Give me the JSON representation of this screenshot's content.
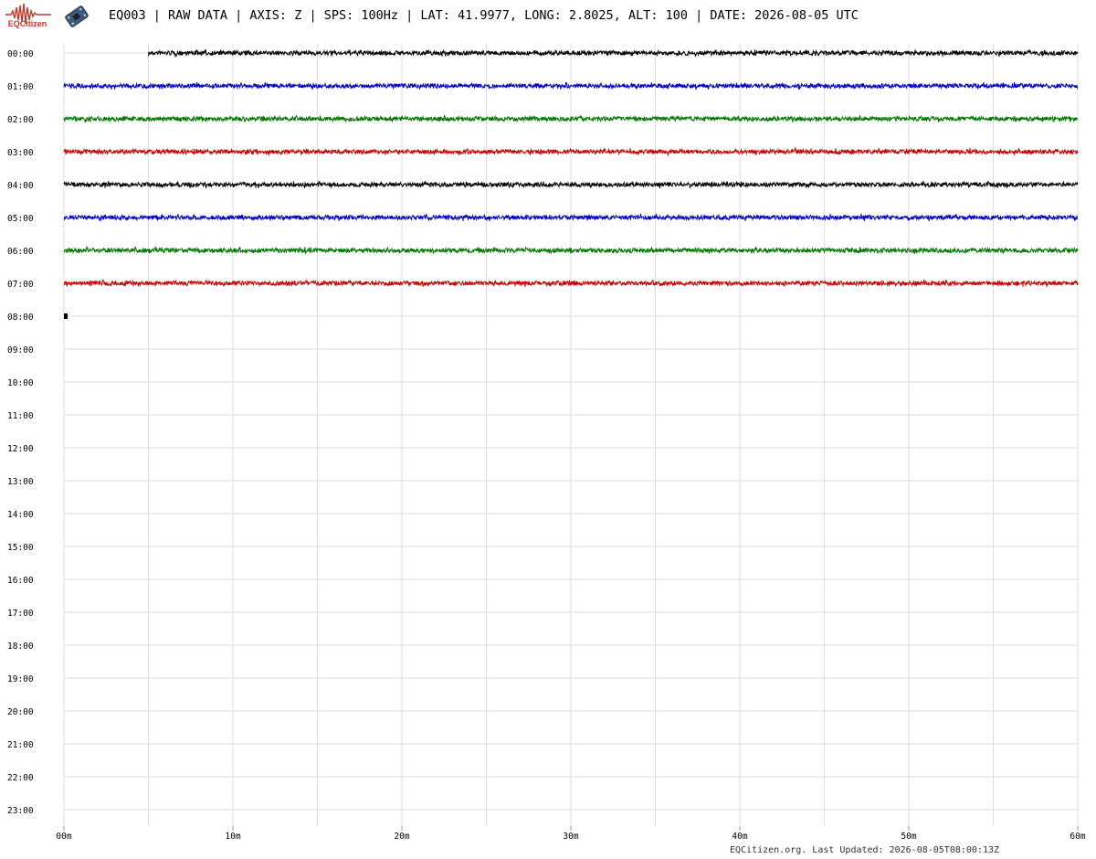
{
  "header": {
    "logo_text": "EQCitizen",
    "title": "EQ003 | RAW DATA | AXIS: Z | SPS: 100Hz | LAT: 41.9977, LONG: 2.8025, ALT: 100 | DATE: 2026-08-05 UTC"
  },
  "footer": {
    "text": "EQCitizen.org. Last Updated: 2026-08-05T08:00:13Z"
  },
  "colors": {
    "black": "#000000",
    "blue": "#0000cc",
    "green": "#007700",
    "red": "#cc0000",
    "grid": "#dddddd",
    "logo": "#c0392b"
  },
  "chart_data": {
    "type": "line",
    "title": "",
    "xlabel": "",
    "ylabel": "",
    "x_ticks": [
      "00m",
      "10m",
      "20m",
      "30m",
      "40m",
      "50m",
      "60m"
    ],
    "x_range_minutes": [
      0,
      60
    ],
    "grid_minor_every_minutes": 5,
    "y_labels": [
      "00:00",
      "01:00",
      "02:00",
      "03:00",
      "04:00",
      "05:00",
      "06:00",
      "07:00",
      "08:00",
      "09:00",
      "10:00",
      "11:00",
      "12:00",
      "13:00",
      "14:00",
      "15:00",
      "16:00",
      "17:00",
      "18:00",
      "19:00",
      "20:00",
      "21:00",
      "22:00",
      "23:00"
    ],
    "trace_color_cycle": [
      "black",
      "blue",
      "green",
      "red"
    ],
    "traces": [
      {
        "hour": "00:00",
        "start_min": 5,
        "end_min": 60,
        "color": "black"
      },
      {
        "hour": "01:00",
        "start_min": 0,
        "end_min": 60,
        "color": "blue"
      },
      {
        "hour": "02:00",
        "start_min": 0,
        "end_min": 60,
        "color": "green"
      },
      {
        "hour": "03:00",
        "start_min": 0,
        "end_min": 60,
        "color": "red"
      },
      {
        "hour": "04:00",
        "start_min": 0,
        "end_min": 60,
        "color": "black"
      },
      {
        "hour": "05:00",
        "start_min": 0,
        "end_min": 60,
        "color": "blue"
      },
      {
        "hour": "06:00",
        "start_min": 0,
        "end_min": 60,
        "color": "green"
      },
      {
        "hour": "07:00",
        "start_min": 0,
        "end_min": 60,
        "color": "red"
      },
      {
        "hour": "08:00",
        "start_min": 0,
        "end_min": 0.2,
        "color": "black"
      }
    ]
  }
}
